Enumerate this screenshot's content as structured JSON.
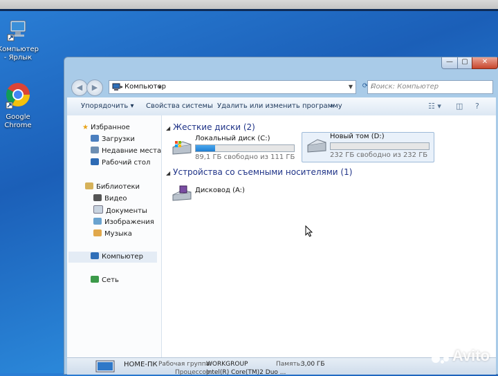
{
  "desktop": {
    "icons": [
      {
        "label": "Компьютер - Ярлык",
        "icon": "computer-shortcut-icon"
      },
      {
        "label": "Google Chrome",
        "icon": "chrome-icon"
      }
    ]
  },
  "window": {
    "address": {
      "path": "Компьютер"
    },
    "search": {
      "placeholder": "Поиск: Компьютер"
    },
    "toolbar": {
      "organize": "Упорядочить ▾",
      "system_properties": "Свойства системы",
      "uninstall": "Удалить или изменить программу",
      "more": "»"
    },
    "nav": {
      "favorites": "Избранное",
      "downloads": "Загрузки",
      "recent": "Недавние места",
      "desktop": "Рабочий стол",
      "libraries": "Библиотеки",
      "video": "Видео",
      "documents": "Документы",
      "pictures": "Изображения",
      "music": "Музыка",
      "computer": "Компьютер",
      "network": "Сеть"
    },
    "content": {
      "hdd_group": "Жесткие диски (2)",
      "removable_group": "Устройства со съемными носителями (1)",
      "drives": [
        {
          "name": "Локальный диск (C:)",
          "free": "89,1 ГБ свободно из 111 ГБ",
          "used_fraction": 0.2
        },
        {
          "name": "Новый том (D:)",
          "free": "232 ГБ свободно из 232 ГБ",
          "used_fraction": 0.0
        }
      ],
      "floppy": "Дисковод (A:)"
    },
    "status": {
      "pc_name": "HOME-ПК",
      "workgroup_label": "Рабочая группа:",
      "workgroup": "WORKGROUP",
      "memory_label": "Память:",
      "memory": "3,00 ГБ",
      "cpu_label": "Процессор:",
      "cpu": "Intel(R) Core(TM)2 Duo ..."
    }
  },
  "watermark": "Avito",
  "colors": {
    "accent": "#1f7fd2",
    "group_heading": "#1e3287"
  }
}
